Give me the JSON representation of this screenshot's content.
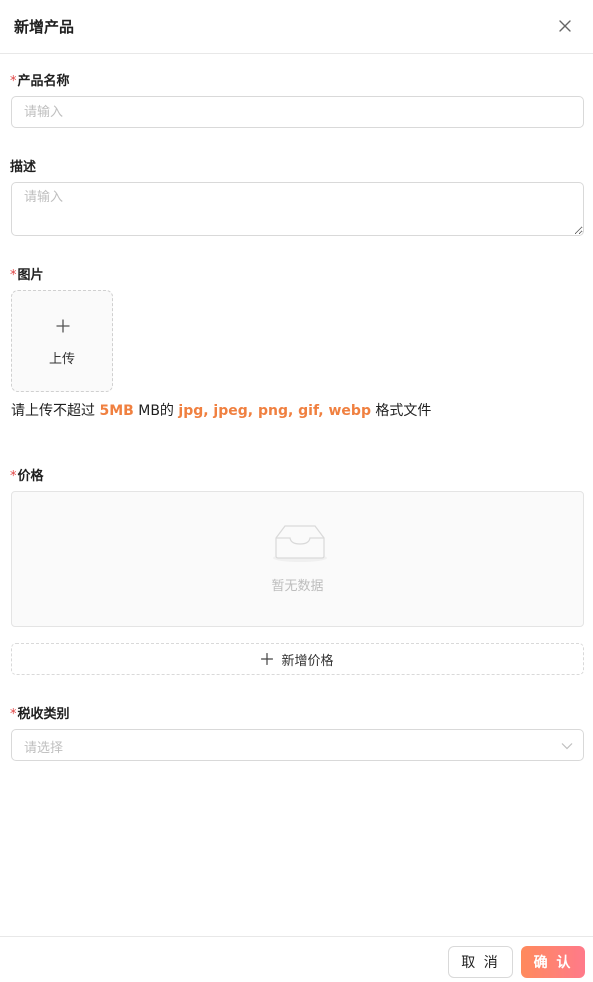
{
  "dialog": {
    "title": "新增产品",
    "close_icon": "close-icon"
  },
  "form": {
    "product_name": {
      "label": "产品名称",
      "required_mark": "*",
      "placeholder": "请输入"
    },
    "description": {
      "label": "描述",
      "placeholder": "请输入"
    },
    "image": {
      "label": "图片",
      "required_mark": "*",
      "upload_label": "上传",
      "hint_prefix": "请上传不超过",
      "hint_size": "5MB",
      "hint_unit": "MB的",
      "hint_formats": "jpg, jpeg, png, gif, webp",
      "hint_suffix": "格式文件"
    },
    "price": {
      "label": "价格",
      "required_mark": "*",
      "empty_text": "暂无数据",
      "add_button": "新增价格"
    },
    "tax_category": {
      "label": "税收类别",
      "required_mark": "*",
      "placeholder": "请选择"
    }
  },
  "footer": {
    "cancel_label": "取 消",
    "confirm_label": "确 认"
  },
  "colors": {
    "accent": "#f08040",
    "required": "#e04545",
    "confirm_gradient_start": "#ff8a5c",
    "confirm_gradient_end": "#ff7a8a"
  }
}
